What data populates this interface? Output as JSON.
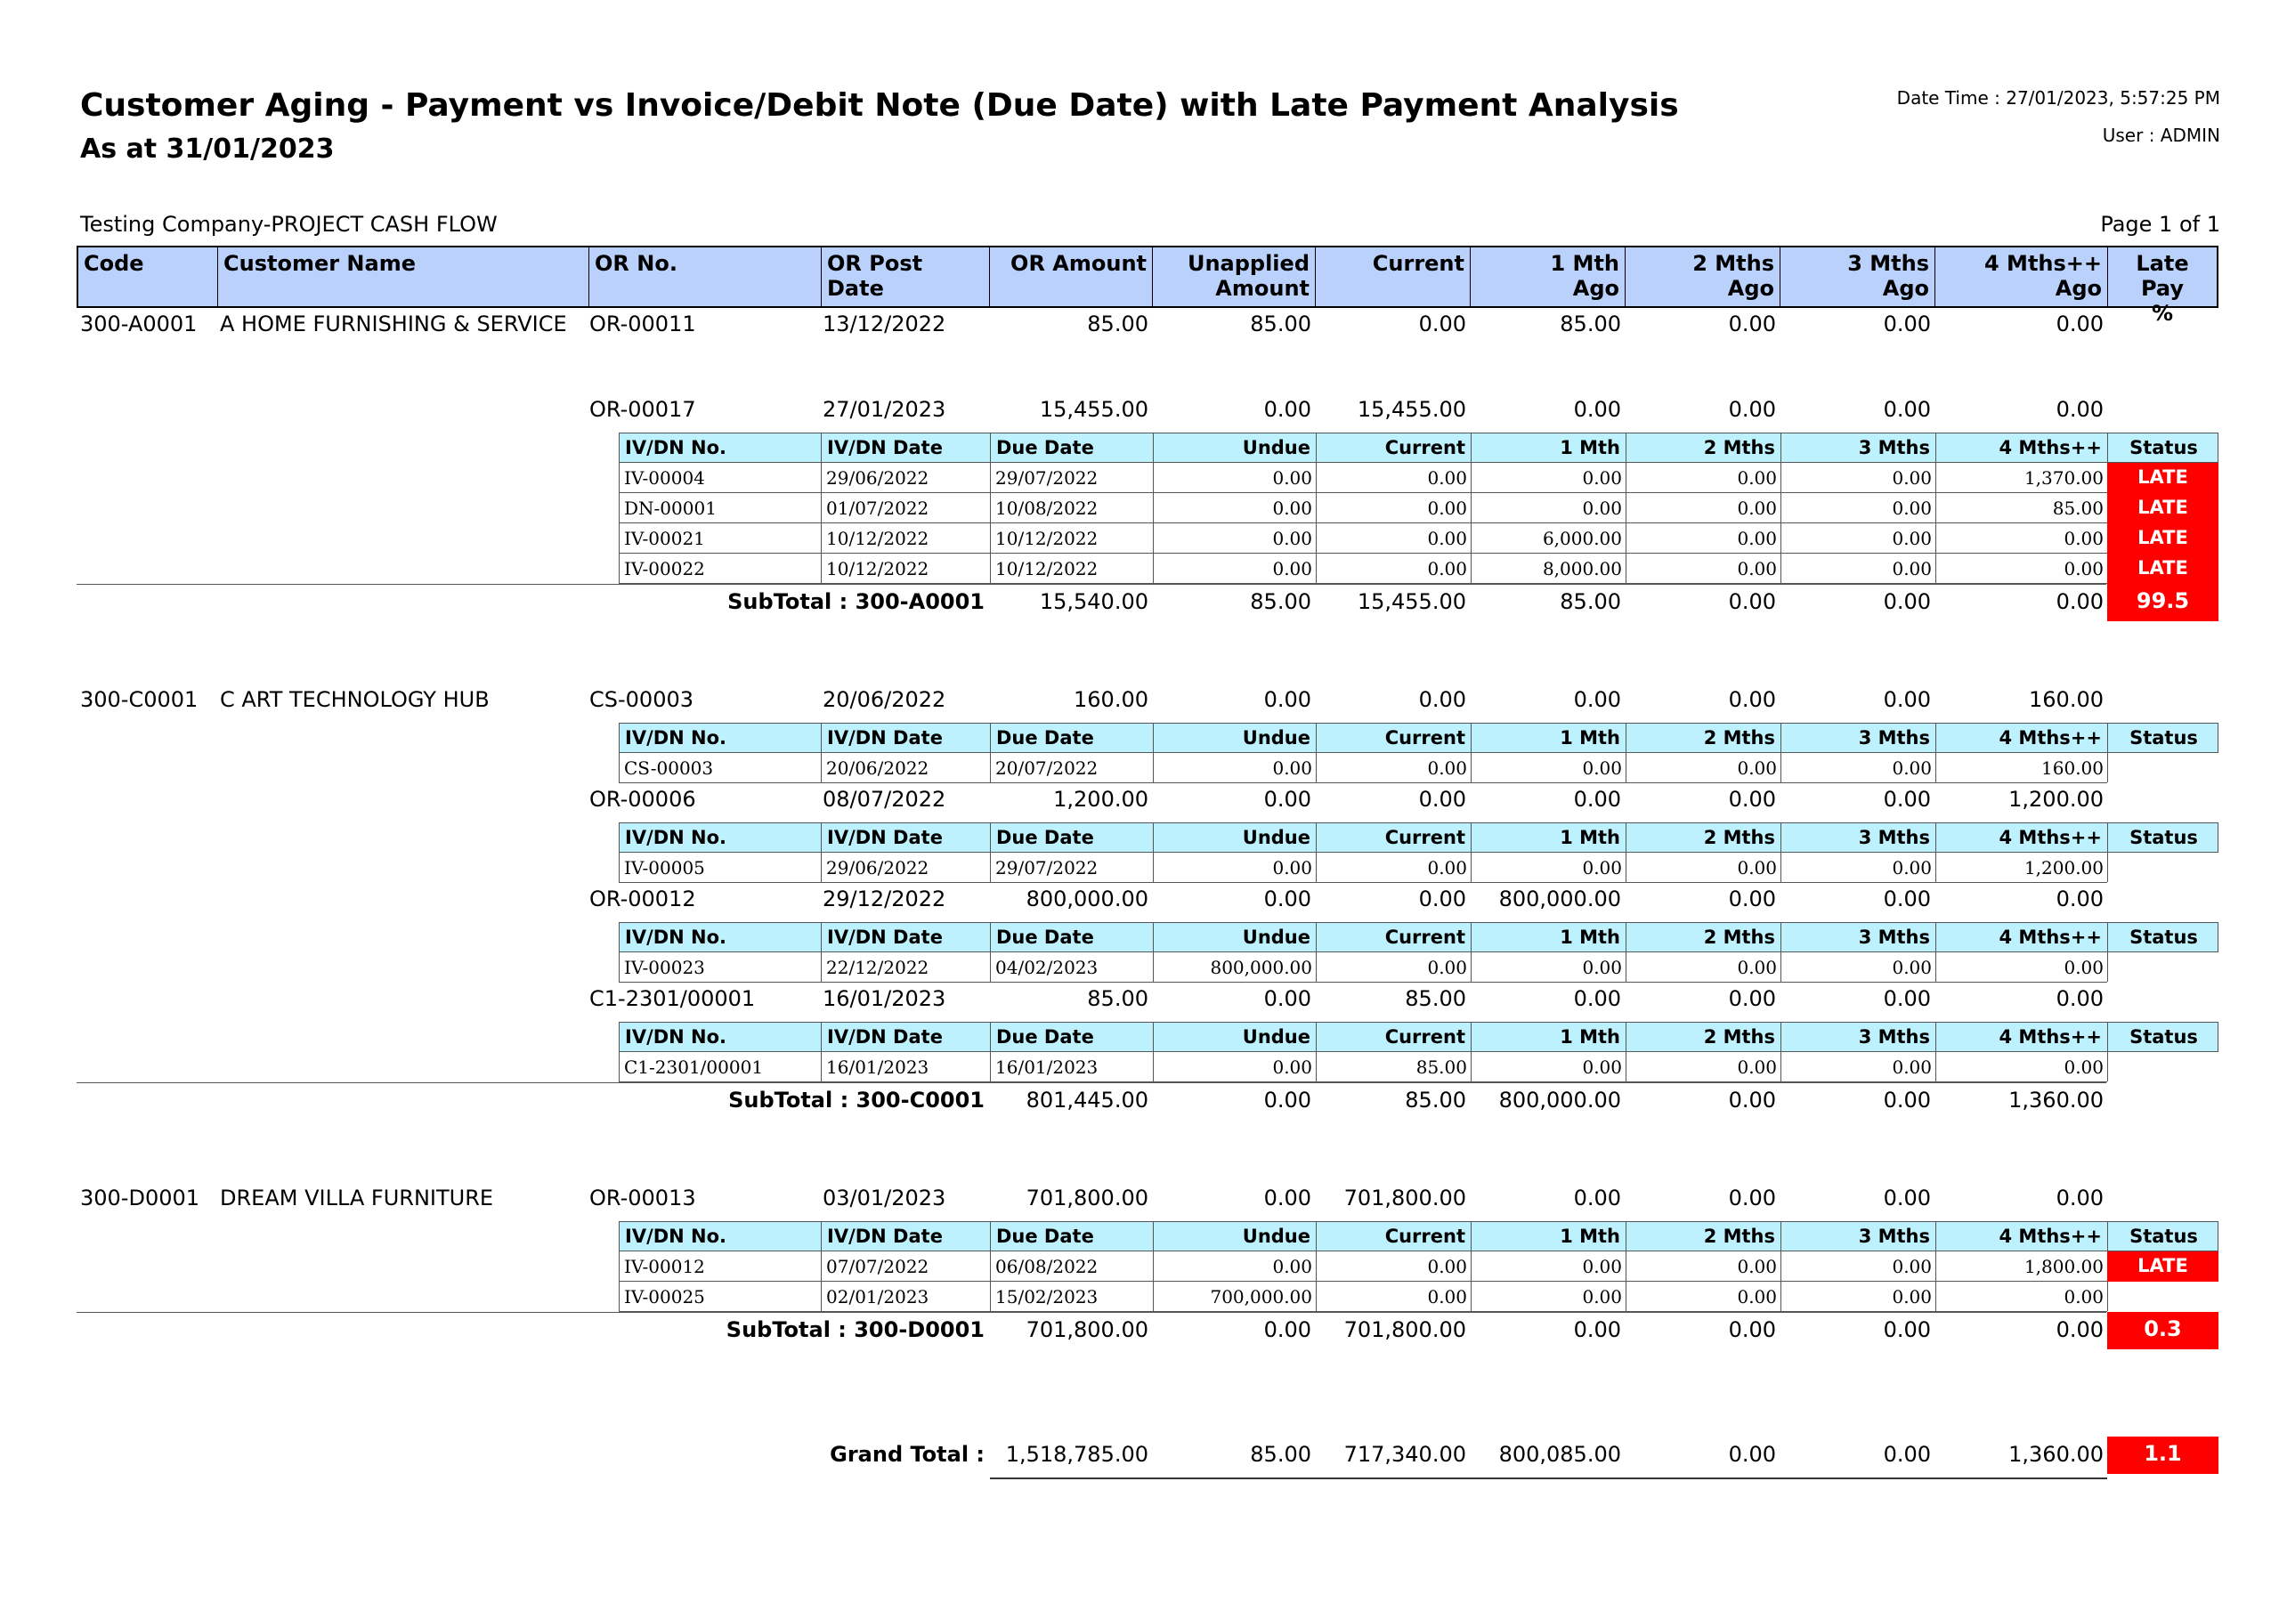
{
  "report": {
    "title": "Customer Aging - Payment vs Invoice/Debit Note (Due Date) with Late Payment Analysis",
    "subtitle": "As at 31/01/2023",
    "datetime": "Date Time : 27/01/2023, 5:57:25 PM",
    "user": "User : ADMIN",
    "company": "Testing Company-PROJECT CASH FLOW",
    "page": "Page 1 of 1"
  },
  "headers": {
    "code": "Code",
    "customer": "Customer Name",
    "or_no": "OR No.",
    "or_post_date": "OR Post Date",
    "or_amount": "OR Amount",
    "unapplied_1": "Unapplied",
    "unapplied_2": "Amount",
    "current": "Current",
    "m1_1": "1 Mth",
    "m1_2": "Ago",
    "m2_1": "2 Mths",
    "m2_2": "Ago",
    "m3_1": "3 Mths",
    "m3_2": "Ago",
    "m4_1": "4 Mths++",
    "m4_2": "Ago",
    "late_1": "Late Pay",
    "late_2": "%"
  },
  "sub_headers": {
    "ivdn": "IV/DN No.",
    "ivdn_date": "IV/DN Date",
    "due": "Due Date",
    "undue": "Undue",
    "current": "Current",
    "m1": "1 Mth",
    "m2": "2 Mths",
    "m3": "3 Mths",
    "m4": "4 Mths++",
    "status": "Status"
  },
  "customers": [
    {
      "code": "300-A0001",
      "name": "A HOME FURNISHING & SERVICE",
      "receipts": [
        {
          "or": "OR-00011",
          "date": "13/12/2022",
          "amount": "85.00",
          "unapplied": "85.00",
          "current": "0.00",
          "m1": "85.00",
          "m2": "0.00",
          "m3": "0.00",
          "m4": "0.00"
        },
        {
          "or": "OR-00017",
          "date": "27/01/2023",
          "amount": "15,455.00",
          "unapplied": "0.00",
          "current": "15,455.00",
          "m1": "0.00",
          "m2": "0.00",
          "m3": "0.00",
          "m4": "0.00",
          "items": [
            {
              "no": "IV-00004",
              "date": "29/06/2022",
              "due": "29/07/2022",
              "undue": "0.00",
              "current": "0.00",
              "m1": "0.00",
              "m2": "0.00",
              "m3": "0.00",
              "m4": "1,370.00",
              "status": "LATE"
            },
            {
              "no": "DN-00001",
              "date": "01/07/2022",
              "due": "10/08/2022",
              "undue": "0.00",
              "current": "0.00",
              "m1": "0.00",
              "m2": "0.00",
              "m3": "0.00",
              "m4": "85.00",
              "status": "LATE"
            },
            {
              "no": "IV-00021",
              "date": "10/12/2022",
              "due": "10/12/2022",
              "undue": "0.00",
              "current": "0.00",
              "m1": "6,000.00",
              "m2": "0.00",
              "m3": "0.00",
              "m4": "0.00",
              "status": "LATE"
            },
            {
              "no": "IV-00022",
              "date": "10/12/2022",
              "due": "10/12/2022",
              "undue": "0.00",
              "current": "0.00",
              "m1": "8,000.00",
              "m2": "0.00",
              "m3": "0.00",
              "m4": "0.00",
              "status": "LATE"
            }
          ]
        }
      ],
      "subtotal": {
        "label": "SubTotal : 300-A0001",
        "amount": "15,540.00",
        "unapplied": "85.00",
        "current": "15,455.00",
        "m1": "85.00",
        "m2": "0.00",
        "m3": "0.00",
        "m4": "0.00",
        "late_pct": "99.5"
      }
    },
    {
      "code": "300-C0001",
      "name": "C ART TECHNOLOGY HUB",
      "receipts": [
        {
          "or": "CS-00003",
          "date": "20/06/2022",
          "amount": "160.00",
          "unapplied": "0.00",
          "current": "0.00",
          "m1": "0.00",
          "m2": "0.00",
          "m3": "0.00",
          "m4": "160.00",
          "items": [
            {
              "no": "CS-00003",
              "date": "20/06/2022",
              "due": "20/07/2022",
              "undue": "0.00",
              "current": "0.00",
              "m1": "0.00",
              "m2": "0.00",
              "m3": "0.00",
              "m4": "160.00",
              "status": ""
            }
          ]
        },
        {
          "or": "OR-00006",
          "date": "08/07/2022",
          "amount": "1,200.00",
          "unapplied": "0.00",
          "current": "0.00",
          "m1": "0.00",
          "m2": "0.00",
          "m3": "0.00",
          "m4": "1,200.00",
          "items": [
            {
              "no": "IV-00005",
              "date": "29/06/2022",
              "due": "29/07/2022",
              "undue": "0.00",
              "current": "0.00",
              "m1": "0.00",
              "m2": "0.00",
              "m3": "0.00",
              "m4": "1,200.00",
              "status": ""
            }
          ]
        },
        {
          "or": "OR-00012",
          "date": "29/12/2022",
          "amount": "800,000.00",
          "unapplied": "0.00",
          "current": "0.00",
          "m1": "800,000.00",
          "m2": "0.00",
          "m3": "0.00",
          "m4": "0.00",
          "items": [
            {
              "no": "IV-00023",
              "date": "22/12/2022",
              "due": "04/02/2023",
              "undue": "800,000.00",
              "current": "0.00",
              "m1": "0.00",
              "m2": "0.00",
              "m3": "0.00",
              "m4": "0.00",
              "status": ""
            }
          ]
        },
        {
          "or": "C1-2301/00001",
          "date": "16/01/2023",
          "amount": "85.00",
          "unapplied": "0.00",
          "current": "85.00",
          "m1": "0.00",
          "m2": "0.00",
          "m3": "0.00",
          "m4": "0.00",
          "items": [
            {
              "no": "C1-2301/00001",
              "date": "16/01/2023",
              "due": "16/01/2023",
              "undue": "0.00",
              "current": "85.00",
              "m1": "0.00",
              "m2": "0.00",
              "m3": "0.00",
              "m4": "0.00",
              "status": ""
            }
          ]
        }
      ],
      "subtotal": {
        "label": "SubTotal : 300-C0001",
        "amount": "801,445.00",
        "unapplied": "0.00",
        "current": "85.00",
        "m1": "800,000.00",
        "m2": "0.00",
        "m3": "0.00",
        "m4": "1,360.00",
        "late_pct": ""
      }
    },
    {
      "code": "300-D0001",
      "name": "DREAM VILLA FURNITURE",
      "receipts": [
        {
          "or": "OR-00013",
          "date": "03/01/2023",
          "amount": "701,800.00",
          "unapplied": "0.00",
          "current": "701,800.00",
          "m1": "0.00",
          "m2": "0.00",
          "m3": "0.00",
          "m4": "0.00",
          "items": [
            {
              "no": "IV-00012",
              "date": "07/07/2022",
              "due": "06/08/2022",
              "undue": "0.00",
              "current": "0.00",
              "m1": "0.00",
              "m2": "0.00",
              "m3": "0.00",
              "m4": "1,800.00",
              "status": "LATE"
            },
            {
              "no": "IV-00025",
              "date": "02/01/2023",
              "due": "15/02/2023",
              "undue": "700,000.00",
              "current": "0.00",
              "m1": "0.00",
              "m2": "0.00",
              "m3": "0.00",
              "m4": "0.00",
              "status": ""
            }
          ]
        }
      ],
      "subtotal": {
        "label": "SubTotal : 300-D0001",
        "amount": "701,800.00",
        "unapplied": "0.00",
        "current": "701,800.00",
        "m1": "0.00",
        "m2": "0.00",
        "m3": "0.00",
        "m4": "0.00",
        "late_pct": "0.3"
      }
    }
  ],
  "grand_total": {
    "label": "Grand Total :",
    "amount": "1,518,785.00",
    "unapplied": "85.00",
    "current": "717,340.00",
    "m1": "800,085.00",
    "m2": "0.00",
    "m3": "0.00",
    "m4": "1,360.00",
    "late_pct": "1.1"
  }
}
